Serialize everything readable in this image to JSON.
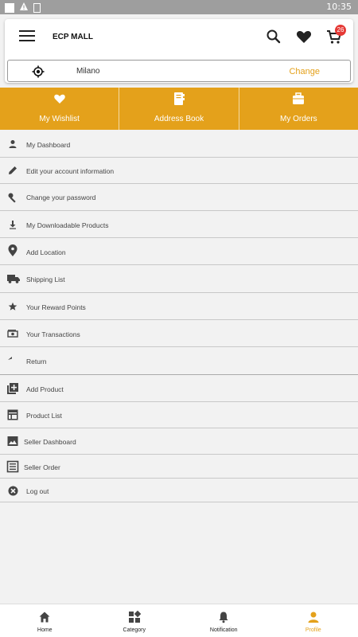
{
  "status": {
    "time": "10:35"
  },
  "header": {
    "title": "ECP MALL",
    "cart_count": "26"
  },
  "location": {
    "city": "Milano",
    "change_label": "Change"
  },
  "quick": [
    {
      "label": "My Wishlist"
    },
    {
      "label": "Address Book"
    },
    {
      "label": "My Orders"
    }
  ],
  "menu": [
    {
      "label": "My Dashboard",
      "icon": "person-icon"
    },
    {
      "label": "Edit your account information",
      "icon": "pencil-icon"
    },
    {
      "label": "Change your password",
      "icon": "wrench-icon"
    },
    {
      "label": "My Downloadable Products",
      "icon": "download-icon"
    },
    {
      "label": "Add Location",
      "icon": "location-pin-icon"
    },
    {
      "label": "Shipping List",
      "icon": "truck-icon"
    },
    {
      "label": "Your Reward Points",
      "icon": "star-icon"
    },
    {
      "label": "Your Transactions",
      "icon": "money-icon"
    },
    {
      "label": "Return",
      "icon": "reply-icon"
    },
    {
      "label": "Add Product",
      "icon": "add-box-icon"
    },
    {
      "label": "Product List",
      "icon": "list-box-icon"
    },
    {
      "label": "Seller Dashboard",
      "icon": "dashboard-image-icon"
    },
    {
      "label": "Seller Order",
      "icon": "order-box-icon"
    },
    {
      "label": "Log out",
      "icon": "close-circle-icon"
    }
  ],
  "nav": [
    {
      "label": "Home"
    },
    {
      "label": "Category"
    },
    {
      "label": "Notification"
    },
    {
      "label": "Profile"
    }
  ],
  "colors": {
    "accent": "#e4a11b",
    "badge": "#e53935"
  }
}
